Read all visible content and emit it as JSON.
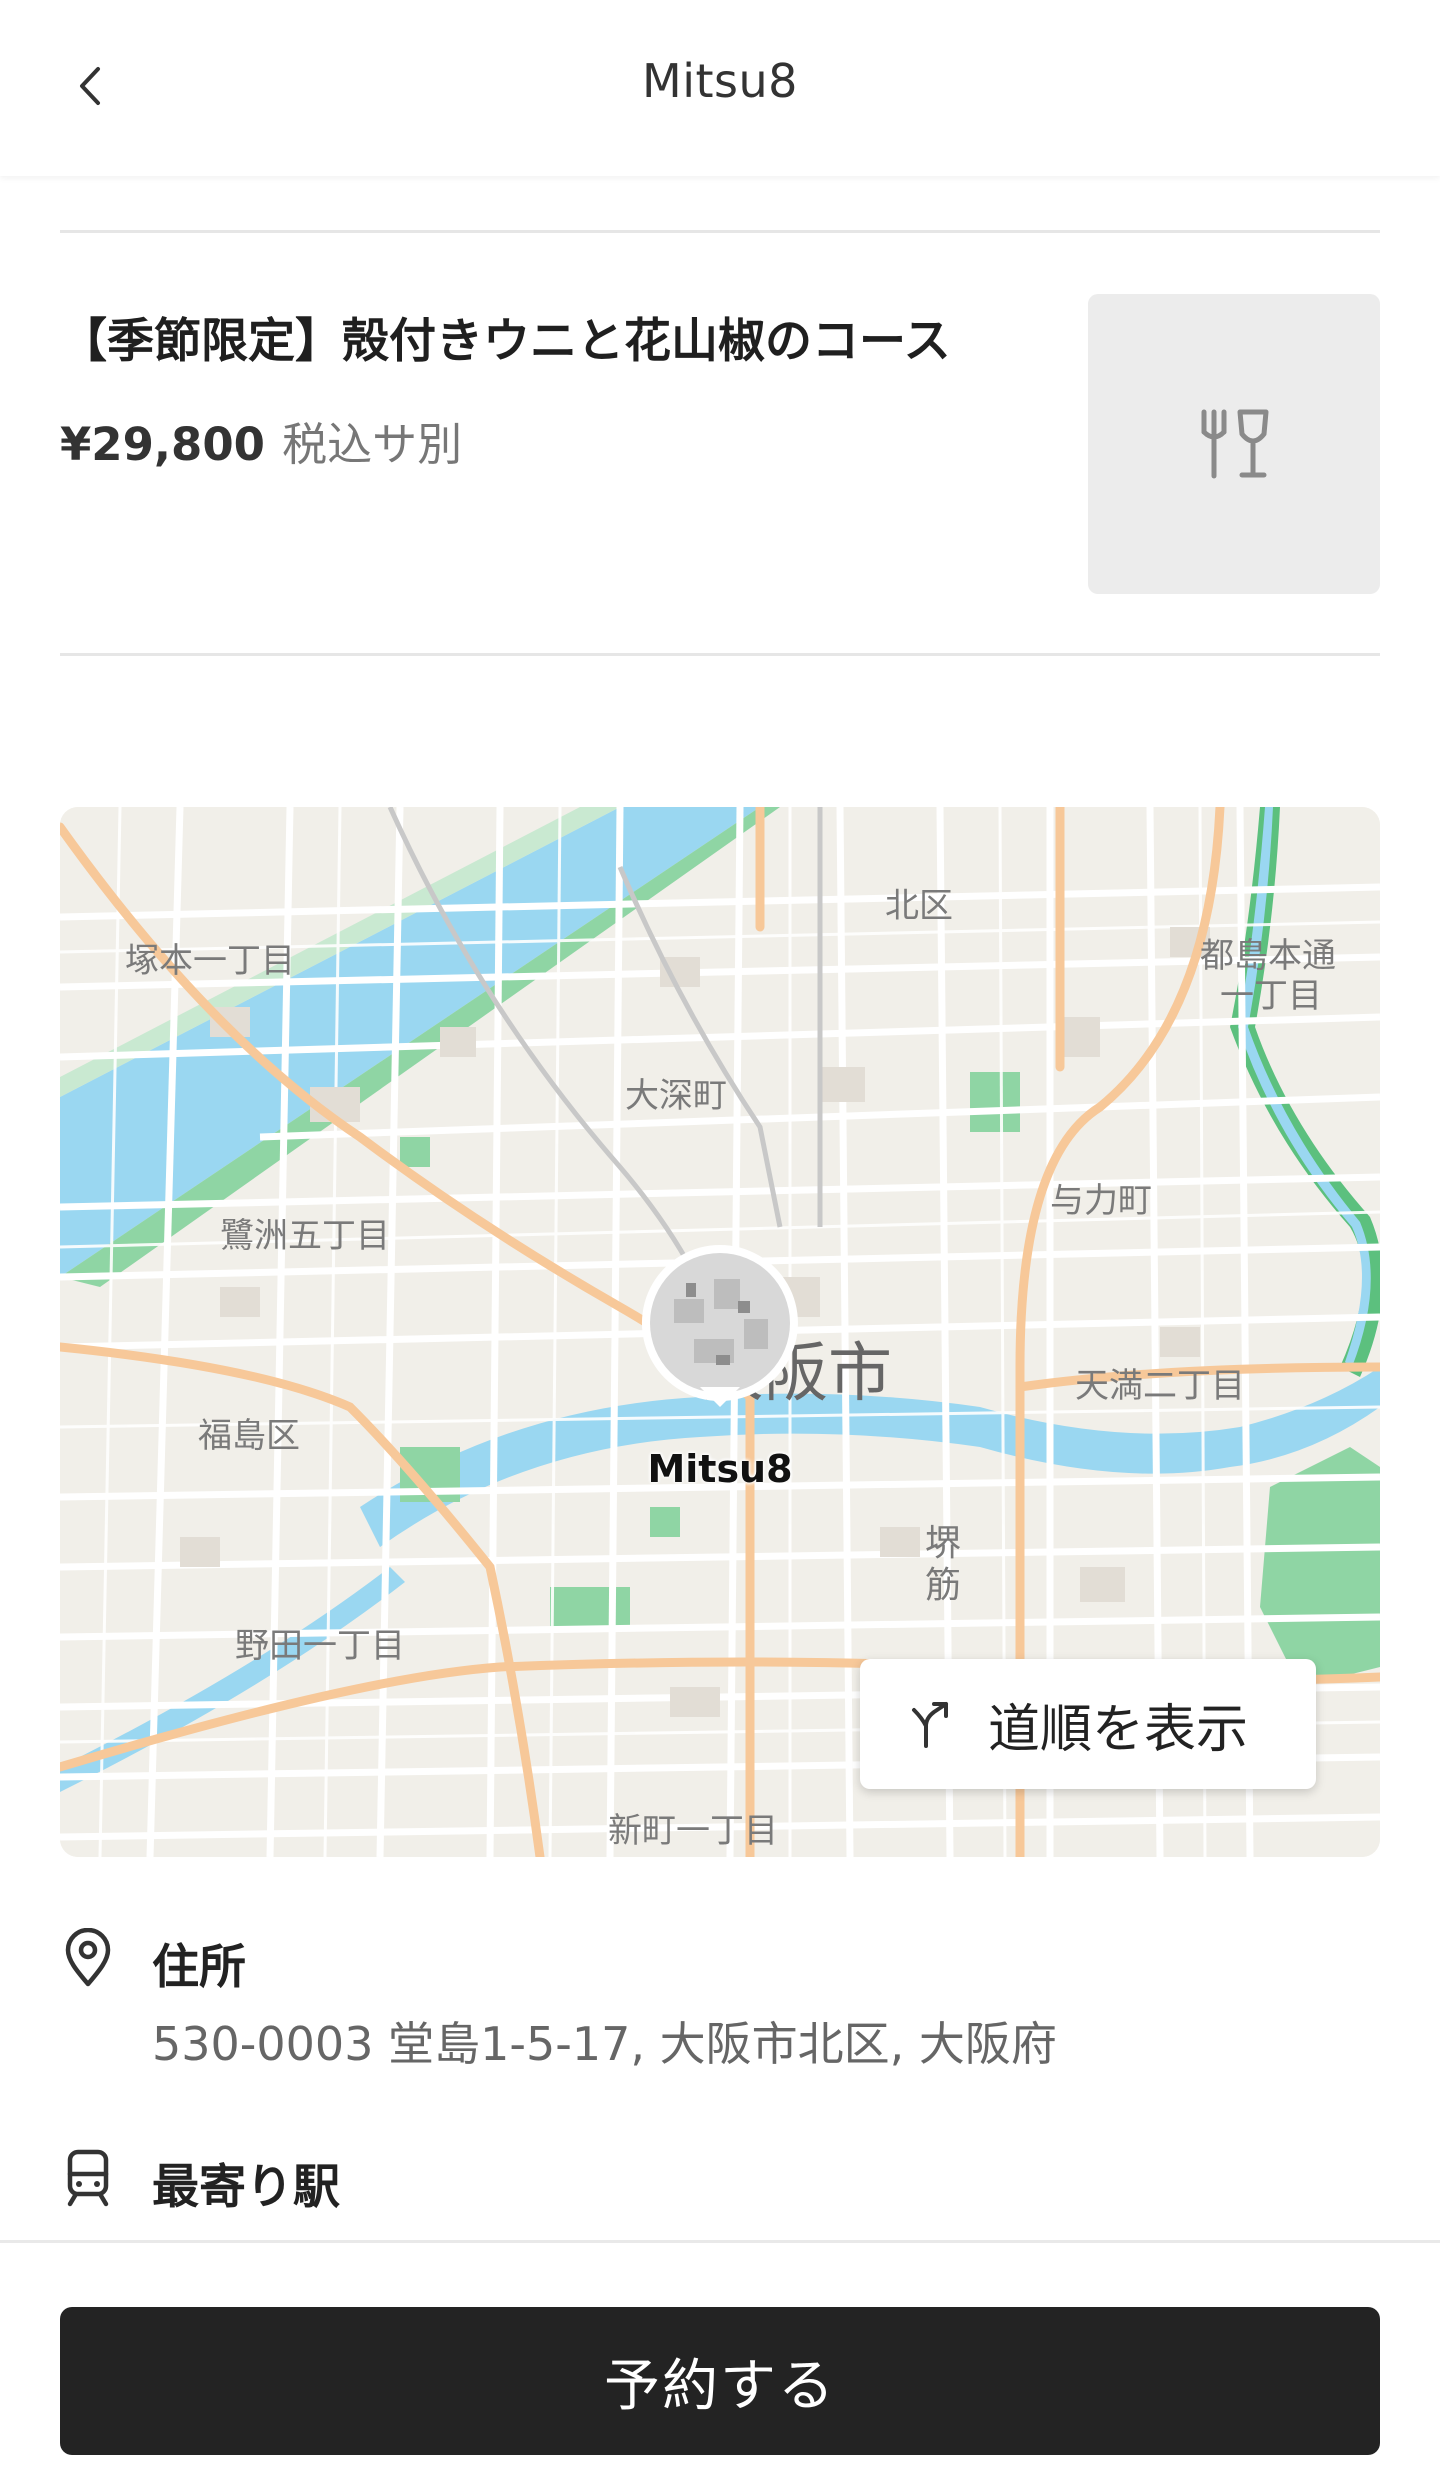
{
  "header": {
    "title": "Mitsu8"
  },
  "course": {
    "title": "【季節限定】殻付きウニと花山椒のコース",
    "price": "¥29,800",
    "tax_note": "税込サ別"
  },
  "map": {
    "marker_name": "Mitsu8",
    "directions_label": "道順を表示",
    "labels": {
      "kita": "北区",
      "tsukamoto": "塚本一丁目",
      "miyakojima1": "都島本通",
      "miyakojima2": "一丁目",
      "ofuka": "大深町",
      "yoriki": "与力町",
      "sagisu": "鷺洲五丁目",
      "osaka": "大阪市",
      "tenma": "天満二丁目",
      "fukushima": "福島区",
      "sakai1": "堺",
      "sakai2": "筋",
      "noda": "野田一丁目",
      "shinmachi": "新町一丁目"
    },
    "colors": {
      "land": "#f1efe9",
      "water": "#9ad7f1",
      "park": "#8fd5a4",
      "main_road": "#f7c899",
      "road": "#ffffff"
    }
  },
  "address": {
    "heading": "住所",
    "value": "530-0003 堂島1-5-17, 大阪市北区, 大阪府"
  },
  "station": {
    "heading": "最寄り駅"
  },
  "footer": {
    "reserve_label": "予約する"
  }
}
